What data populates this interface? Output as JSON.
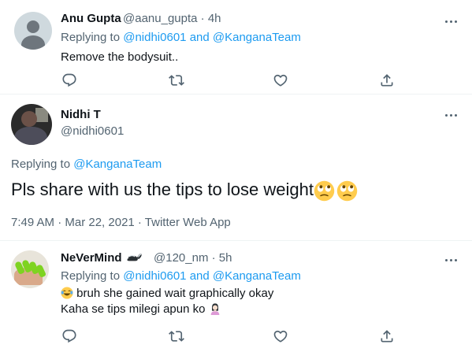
{
  "tweet1": {
    "name": "Anu Gupta",
    "handle": "@aanu_gupta",
    "sep": "·",
    "time": "4h",
    "replying_to": "Replying to",
    "mention1": "@nidhi0601",
    "and": "and",
    "mention2": "@KanganaTeam",
    "text": "Remove the bodysuit.."
  },
  "tweet2": {
    "name": "Nidhi T",
    "handle": "@nidhi0601",
    "replying_to": "Replying to",
    "mention": "@KanganaTeam",
    "text": "Pls share with us the tips to lose weight",
    "emojis": [
      "face-with-rolling-eyes",
      "face-with-rolling-eyes"
    ],
    "timestamp": "7:49 AM · Mar 22, 2021 · Twitter Web App"
  },
  "tweet3": {
    "name": "NeVerMind",
    "name_emoji": "skunk",
    "handle": "@120_nm",
    "sep": "·",
    "time": "5h",
    "replying_to": "Replying to",
    "mention1": "@nidhi0601",
    "and": "and",
    "mention2": "@KanganaTeam",
    "line1_emoji": "face-with-tears-of-joy",
    "line1": "bruh she gained wait graphically okay",
    "line2": "Kaha se tips milegi apun ko",
    "line2_emoji": "woman-shrugging"
  },
  "icons": {
    "reply": "reply-icon",
    "retweet": "retweet-icon",
    "like": "like-icon",
    "share": "share-icon",
    "more": "more-icon"
  },
  "colors": {
    "link": "#1d9bf0",
    "secondary_text": "#536471",
    "primary_text": "#0f1419",
    "divider": "#eff3f4"
  }
}
